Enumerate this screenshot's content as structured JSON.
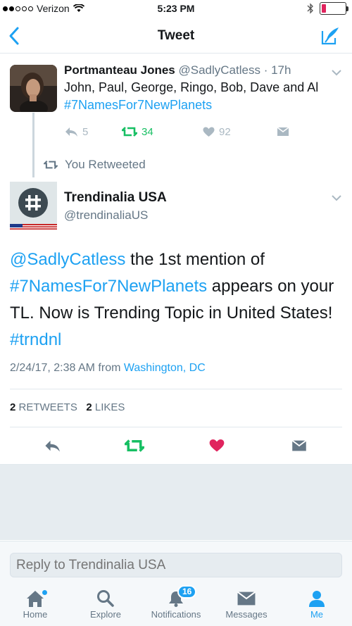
{
  "status_bar": {
    "carrier": "Verizon",
    "time": "5:23 PM",
    "signal_icon": "signal-dots-icon",
    "wifi_icon": "wifi-icon",
    "bluetooth_icon": "bluetooth-icon",
    "battery_icon": "battery-icon",
    "battery_color": "#e0245e"
  },
  "nav": {
    "title": "Tweet",
    "back_icon": "back-chevron-icon",
    "compose_icon": "compose-icon"
  },
  "original_tweet": {
    "name": "Portmanteau Jones",
    "handle": "@SadlyCatless",
    "separator": " · ",
    "time_ago": "17h",
    "text": "John, Paul, George, Ringo, Bob, Dave and Al ",
    "hashtag": "#7NamesFor7NewPlanets",
    "reply_count": "5",
    "retweet_count": "34",
    "like_count": "92"
  },
  "retweeted_label": "You Retweeted",
  "trend_tweet": {
    "name": "Trendinalia USA",
    "handle": "@trendinaliaUS",
    "mention": "@SadlyCatless",
    "text_1": " the 1st mention of ",
    "hashtag": "#7NamesFor7NewPlanets",
    "text_2": " appears on your TL. Now is Trending Topic in United States! ",
    "hashtag_2": "#trndnl",
    "timestamp": "2/24/17, 2:38 AM from ",
    "location": "Washington, DC",
    "retweets_count": "2",
    "retweets_label": " RETWEETS",
    "likes_count": "2",
    "likes_label": " LIKES"
  },
  "reply_box": {
    "placeholder": "Reply to Trendinalia USA"
  },
  "tabs": [
    {
      "label": "Home",
      "icon": "home-icon"
    },
    {
      "label": "Explore",
      "icon": "search-icon"
    },
    {
      "label": "Notifications",
      "icon": "bell-icon",
      "badge": "16"
    },
    {
      "label": "Messages",
      "icon": "envelope-icon"
    },
    {
      "label": "Me",
      "icon": "person-icon"
    }
  ],
  "colors": {
    "accent": "#1da1f2",
    "retweet_green": "#17bf63",
    "like_red": "#e0245e",
    "muted": "#657786"
  }
}
